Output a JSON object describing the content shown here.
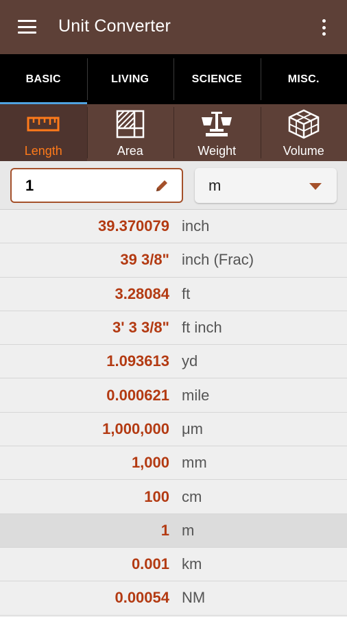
{
  "appbar": {
    "title": "Unit Converter",
    "menu_icon": "hamburger-menu-icon",
    "overflow_icon": "more-vertical-icon"
  },
  "tabs": [
    {
      "label": "BASIC",
      "active": true
    },
    {
      "label": "LIVING",
      "active": false
    },
    {
      "label": "SCIENCE",
      "active": false
    },
    {
      "label": "MISC.",
      "active": false
    }
  ],
  "categories": [
    {
      "label": "Length",
      "icon": "ruler-icon",
      "active": true
    },
    {
      "label": "Area",
      "icon": "area-grid-icon",
      "active": false
    },
    {
      "label": "Weight",
      "icon": "scale-icon",
      "active": false
    },
    {
      "label": "Volume",
      "icon": "cube-icon",
      "active": false
    }
  ],
  "input": {
    "value": "1",
    "unit": "m"
  },
  "results": [
    {
      "value": "39.370079",
      "unit": "inch"
    },
    {
      "value": "39 3/8\"",
      "unit": "inch (Frac)"
    },
    {
      "value": "3.28084",
      "unit": "ft"
    },
    {
      "value": "3' 3 3/8\"",
      "unit": "ft inch"
    },
    {
      "value": "1.093613",
      "unit": "yd"
    },
    {
      "value": "0.000621",
      "unit": "mile"
    },
    {
      "value": "1,000,000",
      "unit": "μm"
    },
    {
      "value": "1,000",
      "unit": "mm"
    },
    {
      "value": "100",
      "unit": "cm"
    },
    {
      "value": "1",
      "unit": "m",
      "current": true
    },
    {
      "value": "0.001",
      "unit": "km"
    },
    {
      "value": "0.00054",
      "unit": "NM"
    }
  ],
  "colors": {
    "brand": "#5d4037",
    "accent": "#ff7a1a",
    "value_text": "#b33a12",
    "tab_indicator": "#4fa3e0"
  }
}
